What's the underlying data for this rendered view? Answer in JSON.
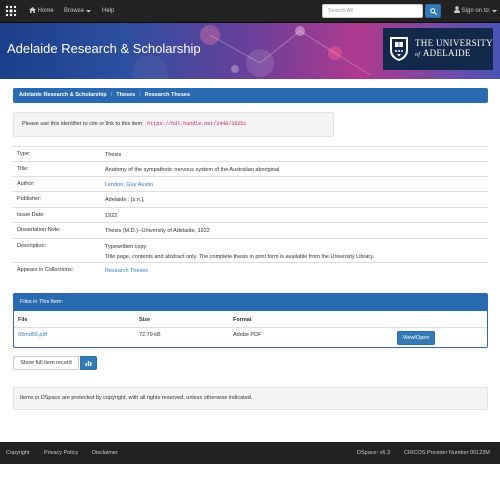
{
  "navbar": {
    "home_label": "Home",
    "browse_label": "Browse",
    "help_label": "Help",
    "search_placeholder": "Search All",
    "signin_label": "Sign on to:"
  },
  "banner": {
    "title": "Adelaide Research & Scholarship",
    "logo_line1": "THE UNIVERSITY",
    "logo_of": "of",
    "logo_line2": "ADELAIDE"
  },
  "breadcrumb": {
    "items": [
      "Adelaide Research & Scholarship",
      "Theses",
      "Research Theses"
    ]
  },
  "cite": {
    "text": "Please use this identifier to cite or link to this item:",
    "url": "https://hdl.handle.net/2440/38251"
  },
  "metadata": [
    {
      "label": "Type:",
      "value": "Thesis"
    },
    {
      "label": "Title:",
      "value": "Anatomy of the sympathetic nervous system of the Australian aboriginal"
    },
    {
      "label": "Author:",
      "value": "Lendon, Guy Austin"
    },
    {
      "label": "Publisher:",
      "value": "Adelaide : [s.n.],"
    },
    {
      "label": "Issue Date:",
      "value": "1922"
    },
    {
      "label": "Dissertation Note:",
      "value": "Thesis (M.D.)--University of Adelaide, 1922"
    },
    {
      "label": "Description:",
      "value": "Typewritten copy",
      "value2": "Title page, contents and abstract only. The complete thesis in print form is available from the University Library."
    },
    {
      "label": "Appears in Collections:",
      "value": "Research Theses"
    }
  ],
  "files": {
    "heading": "Files in This Item:",
    "columns": [
      "File",
      "Size",
      "Format"
    ],
    "rows": [
      {
        "file": "09md56.pdf",
        "size": "72.79 kB",
        "format": "Adobe PDF",
        "action": "View/Open"
      }
    ]
  },
  "actions": {
    "full_record_label": "Show full item record"
  },
  "copyright_text": "Items in DSpace are protected by copyright, with all rights reserved, unless otherwise indicated.",
  "footer": {
    "links": [
      "Copyright",
      "Privacy Policy",
      "Disclaimer"
    ],
    "version": "DSpace: v6.3",
    "cricos": "CRICOS Provider Number 00123M"
  },
  "colors": {
    "navbar_bg": "#222222",
    "primary": "#337ab7",
    "panel_blue": "#2a6ab0",
    "uoa_navy": "#13294b"
  },
  "icons": [
    "dspace-logo-icon",
    "home-icon",
    "chevron-down-icon",
    "search-icon",
    "user-icon",
    "bar-chart-icon",
    "university-crest-icon"
  ]
}
